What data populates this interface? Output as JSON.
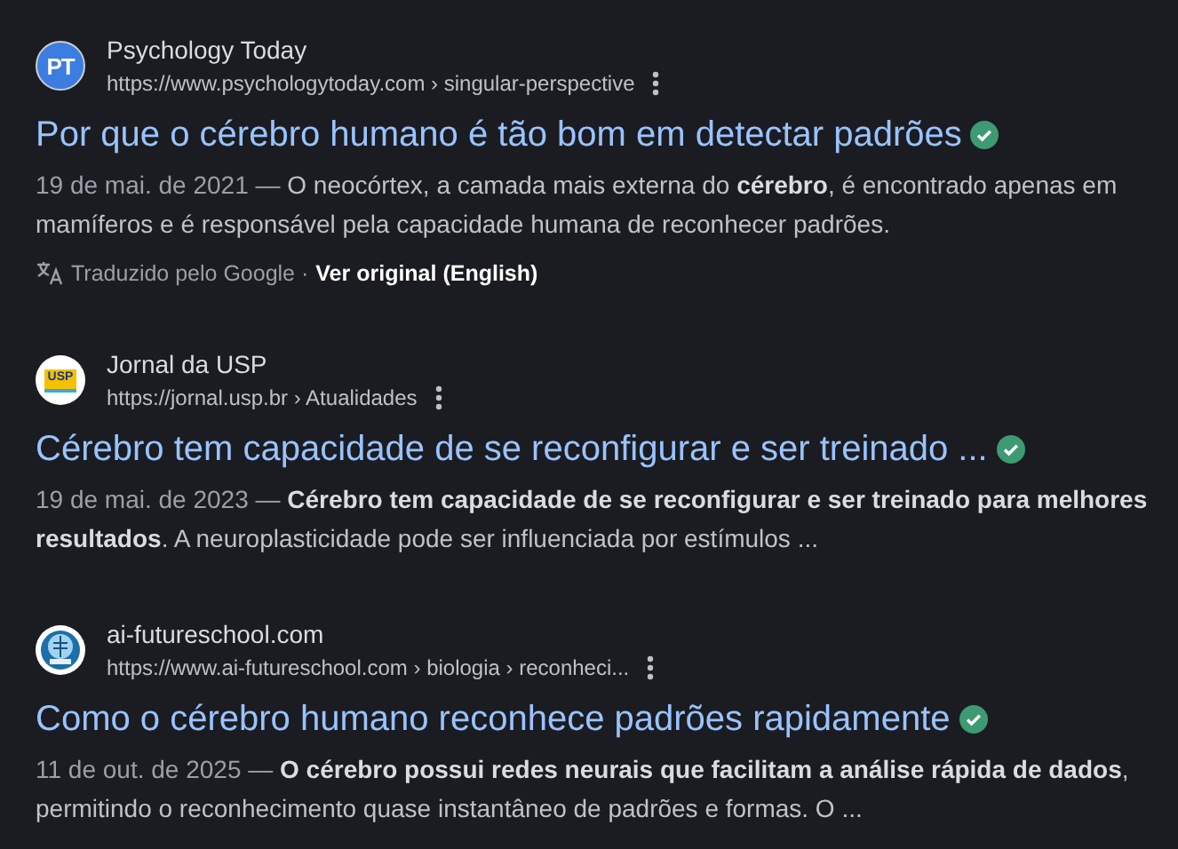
{
  "results": [
    {
      "site": "Psychology Today",
      "url": "https://www.psychologytoday.com › singular-perspective",
      "logo": {
        "kind": "text",
        "text": "PT"
      },
      "title": "Por que o cérebro humano é tão bom em detectar padrões",
      "verified": true,
      "date": "19 de mai. de 2021 —",
      "snippet": "O neocórtex, a camada mais externa do **cérebro**, é encontrado apenas em mamíferos e é responsável pela capacidade humana de reconhecer padrões.",
      "translation": {
        "note": "Traduzido pelo Google ·",
        "link": "Ver original (English)"
      }
    },
    {
      "site": "Jornal da USP",
      "url": "https://jornal.usp.br › Atualidades",
      "logo": {
        "kind": "badge",
        "text": "USP"
      },
      "title": "Cérebro tem capacidade de se reconfigurar e ser treinado ...",
      "verified": true,
      "date": "19 de mai. de 2023 —",
      "snippet": "**Cérebro tem capacidade de se reconfigurar e ser treinado para melhores resultados**. A neuroplasticidade pode ser influenciada por estímulos ..."
    },
    {
      "site": "ai-futureschool.com",
      "url": "https://www.ai-futureschool.com › biologia › reconheci...",
      "logo": {
        "kind": "emblem"
      },
      "title": "Como o cérebro humano reconhece padrões rapidamente",
      "verified": true,
      "date": "11 de out. de 2025 —",
      "snippet": "**O cérebro possui redes neurais que facilitam a análise rápida de dados**, permitindo o reconhecimento quase instantâneo de padrões e formas. O ..."
    }
  ]
}
